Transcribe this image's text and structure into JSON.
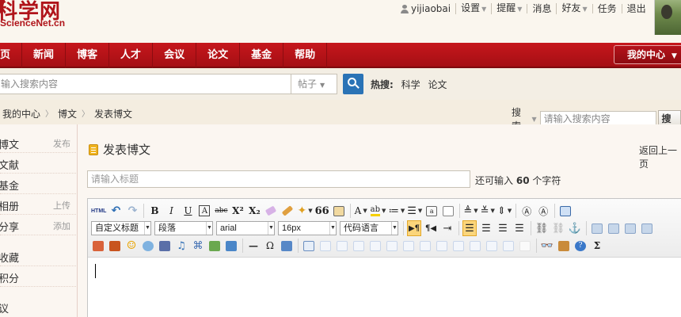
{
  "header": {
    "logo_cn": "科学网",
    "logo_en": "ScienceNet.cn",
    "username": "yijiaobai",
    "menu": [
      "设置",
      "提醒",
      "消息",
      "好友",
      "任务",
      "退出"
    ]
  },
  "nav": {
    "items": [
      "页",
      "新闻",
      "博客",
      "人才",
      "会议",
      "论文",
      "基金",
      "帮助"
    ],
    "my_center": "我的中心"
  },
  "search": {
    "placeholder": "输入搜索内容",
    "type": "帖子",
    "hot_label": "热搜:",
    "hot_terms": [
      "科学",
      "论文"
    ]
  },
  "breadcrumb": [
    "我的中心",
    "博文",
    "发表博文"
  ],
  "site_search": {
    "label": "搜索",
    "placeholder": "请输入搜索内容",
    "button": "搜索"
  },
  "sidebar": [
    {
      "label": "博文",
      "action": "发布"
    },
    {
      "label": "文献",
      "action": ""
    },
    {
      "label": "基金",
      "action": ""
    },
    {
      "label": "相册",
      "action": "上传"
    },
    {
      "label": "分享",
      "action": "添加"
    },
    {
      "label": "收藏",
      "action": ""
    },
    {
      "label": "积分",
      "action": ""
    },
    {
      "label": "议",
      "action": ""
    }
  ],
  "main": {
    "title": "发表博文",
    "back": "返回上一页",
    "title_placeholder": "请输入标题",
    "char_hint_prefix": "还可输入",
    "char_count": "60",
    "char_hint_suffix": "个字符"
  },
  "editor": {
    "row1": {
      "html": "HTML",
      "bold": "B",
      "italic": "I",
      "underline": "U",
      "font_border": "A",
      "strike": "abc",
      "sup": "X²",
      "sub": "X₂",
      "quote": "66",
      "fontcolor": "A",
      "bgcolor": "ab",
      "formula": "Ω",
      "sigma": "Σ"
    },
    "selects": {
      "heading": "自定义标题",
      "paragraph": "段落",
      "font": "arial",
      "size": "16px",
      "code": "代码语言"
    }
  },
  "colors": {
    "brand_red": "#b0141a",
    "nav_red": "#c6171c",
    "search_blue": "#2a73b6",
    "active_yellow": "#fbd57b"
  }
}
